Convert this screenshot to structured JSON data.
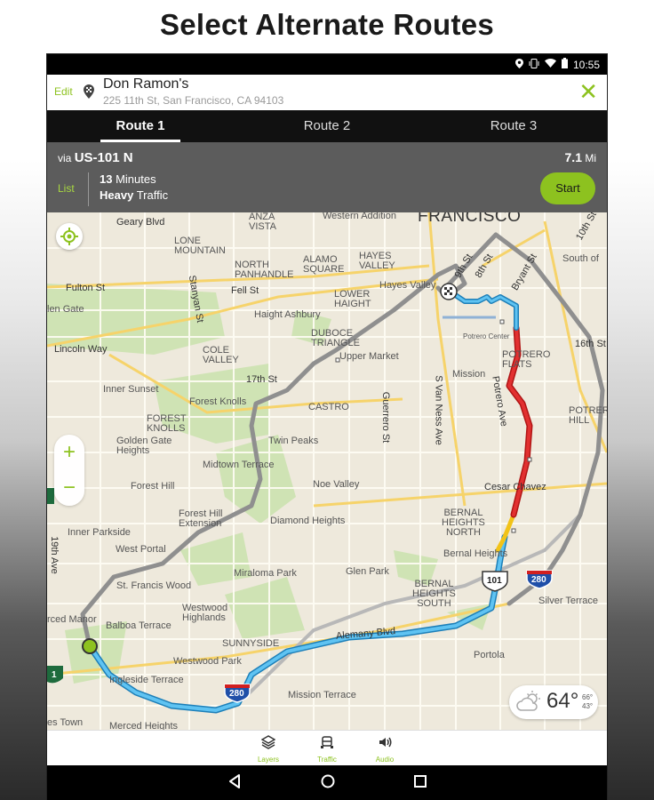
{
  "headline": "Select Alternate Routes",
  "statusbar": {
    "time": "10:55"
  },
  "destination": {
    "edit_label": "Edit",
    "name": "Don Ramon's",
    "address": "225 11th St, San Francisco, CA 94103",
    "close_glyph": "✕"
  },
  "tabs": [
    {
      "label": "Route 1",
      "active": true
    },
    {
      "label": "Route 2",
      "active": false
    },
    {
      "label": "Route 3",
      "active": false
    }
  ],
  "route": {
    "via_prefix": "via",
    "via_road": "US-101 N",
    "distance_value": "7.1",
    "distance_unit": "Mi",
    "list_label": "List",
    "time_value": "13",
    "time_unit": "Minutes",
    "traffic_level": "Heavy",
    "traffic_word": "Traffic",
    "start_label": "Start"
  },
  "map": {
    "labels": {
      "francisco": "FRANCISCO",
      "geary": "Geary Blvd",
      "anza_vista": "ANZA\nVISTA",
      "western_addition": "Western Addition",
      "lone_mountain": "LONE\nMOUNTAIN",
      "alamo_square": "ALAMO\nSQUARE",
      "hayes_valley_area": "HAYES\nVALLEY",
      "hayes_valley": "Hayes Valley",
      "north_panhandle": "NORTH\nPANHANDLE",
      "fulton": "Fulton St",
      "fell": "Fell St",
      "stanyan": "Stanyan St",
      "haight_ashbury": "Haight Ashbury",
      "lower_haight": "LOWER\nHAIGHT",
      "golden_gate": "len Gate",
      "lincoln_way": "Lincoln Way",
      "duboce": "DUBOCE\nTRIANGLE",
      "cole_valley": "COLE\nVALLEY",
      "upper_market": "Upper Market",
      "potrero_center": "Potrero Center",
      "potrero_flats": "POTRERO\nFLATS",
      "south_of": "South of",
      "bryant": "Bryant St",
      "sixteenth": "16th St",
      "eighth": "8th St",
      "ninth": "9th St",
      "tenth": "10th St",
      "seventeenth": "17th St",
      "inner_sunset": "Inner Sunset",
      "forest_knolls": "Forest Knolls",
      "forest_knolls_area": "FOREST\nKNOLLS",
      "castro": "CASTRO",
      "mission": "Mission",
      "guerrero": "Guerrero St",
      "s_van_ness": "S Van Ness Ave",
      "potrero_ave": "Potrero Ave",
      "potrero_hill": "POTRER\nHILL",
      "golden_gate_heights": "Golden Gate\nHeights",
      "twin_peaks": "Twin Peaks",
      "midtown_terrace": "Midtown Terrace",
      "forest_hill": "Forest Hill",
      "noe_valley": "Noe Valley",
      "cesar_chavez": "Cesar Chavez",
      "forest_hill_ext": "Forest Hill\nExtension",
      "diamond_heights": "Diamond Heights",
      "bernal_north": "BERNAL\nHEIGHTS\nNORTH",
      "inner_parkside": "Inner Parkside",
      "nineteenth_ave": "19th Ave",
      "west_portal": "West Portal",
      "bernal_heights": "Bernal Heights",
      "miraloma": "Miraloma Park",
      "glen_park": "Glen Park",
      "st_francis": "St. Francis Wood",
      "bernal_south": "BERNAL\nHEIGHTS\nSOUTH",
      "silver_terrace": "Silver Terrace",
      "merced_manor": "rced Manor",
      "westwood_highlands": "Westwood\nHighlands",
      "balboa_terrace": "Balboa Terrace",
      "alemany": "Alemany Blvd",
      "sunnyside": "SUNNYSIDE",
      "westwood_park": "Westwood Park",
      "portola": "Portola",
      "ingleside_terrace": "Ingleside Terrace",
      "mission_terrace": "Mission Terrace",
      "ms_town": "es Town",
      "merced_heights": "Merced Heights",
      "shield_101": "101",
      "shield_280a": "280",
      "shield_280b": "280",
      "shield_1": "1"
    },
    "zoom_in": "+",
    "zoom_out": "−"
  },
  "weather": {
    "temp": "64°",
    "high": "66°",
    "low": "43°"
  },
  "bottom_bar": [
    {
      "label": "Layers",
      "icon": "layers-icon"
    },
    {
      "label": "Traffic",
      "icon": "car-icon"
    },
    {
      "label": "Audio",
      "icon": "speaker-icon"
    }
  ],
  "colors": {
    "accent": "#8dc21f",
    "route_blue": "#3aa3dd",
    "route_gray": "#8f8f8f",
    "traffic_red": "#d21f1f",
    "traffic_yellow": "#f2c318"
  }
}
